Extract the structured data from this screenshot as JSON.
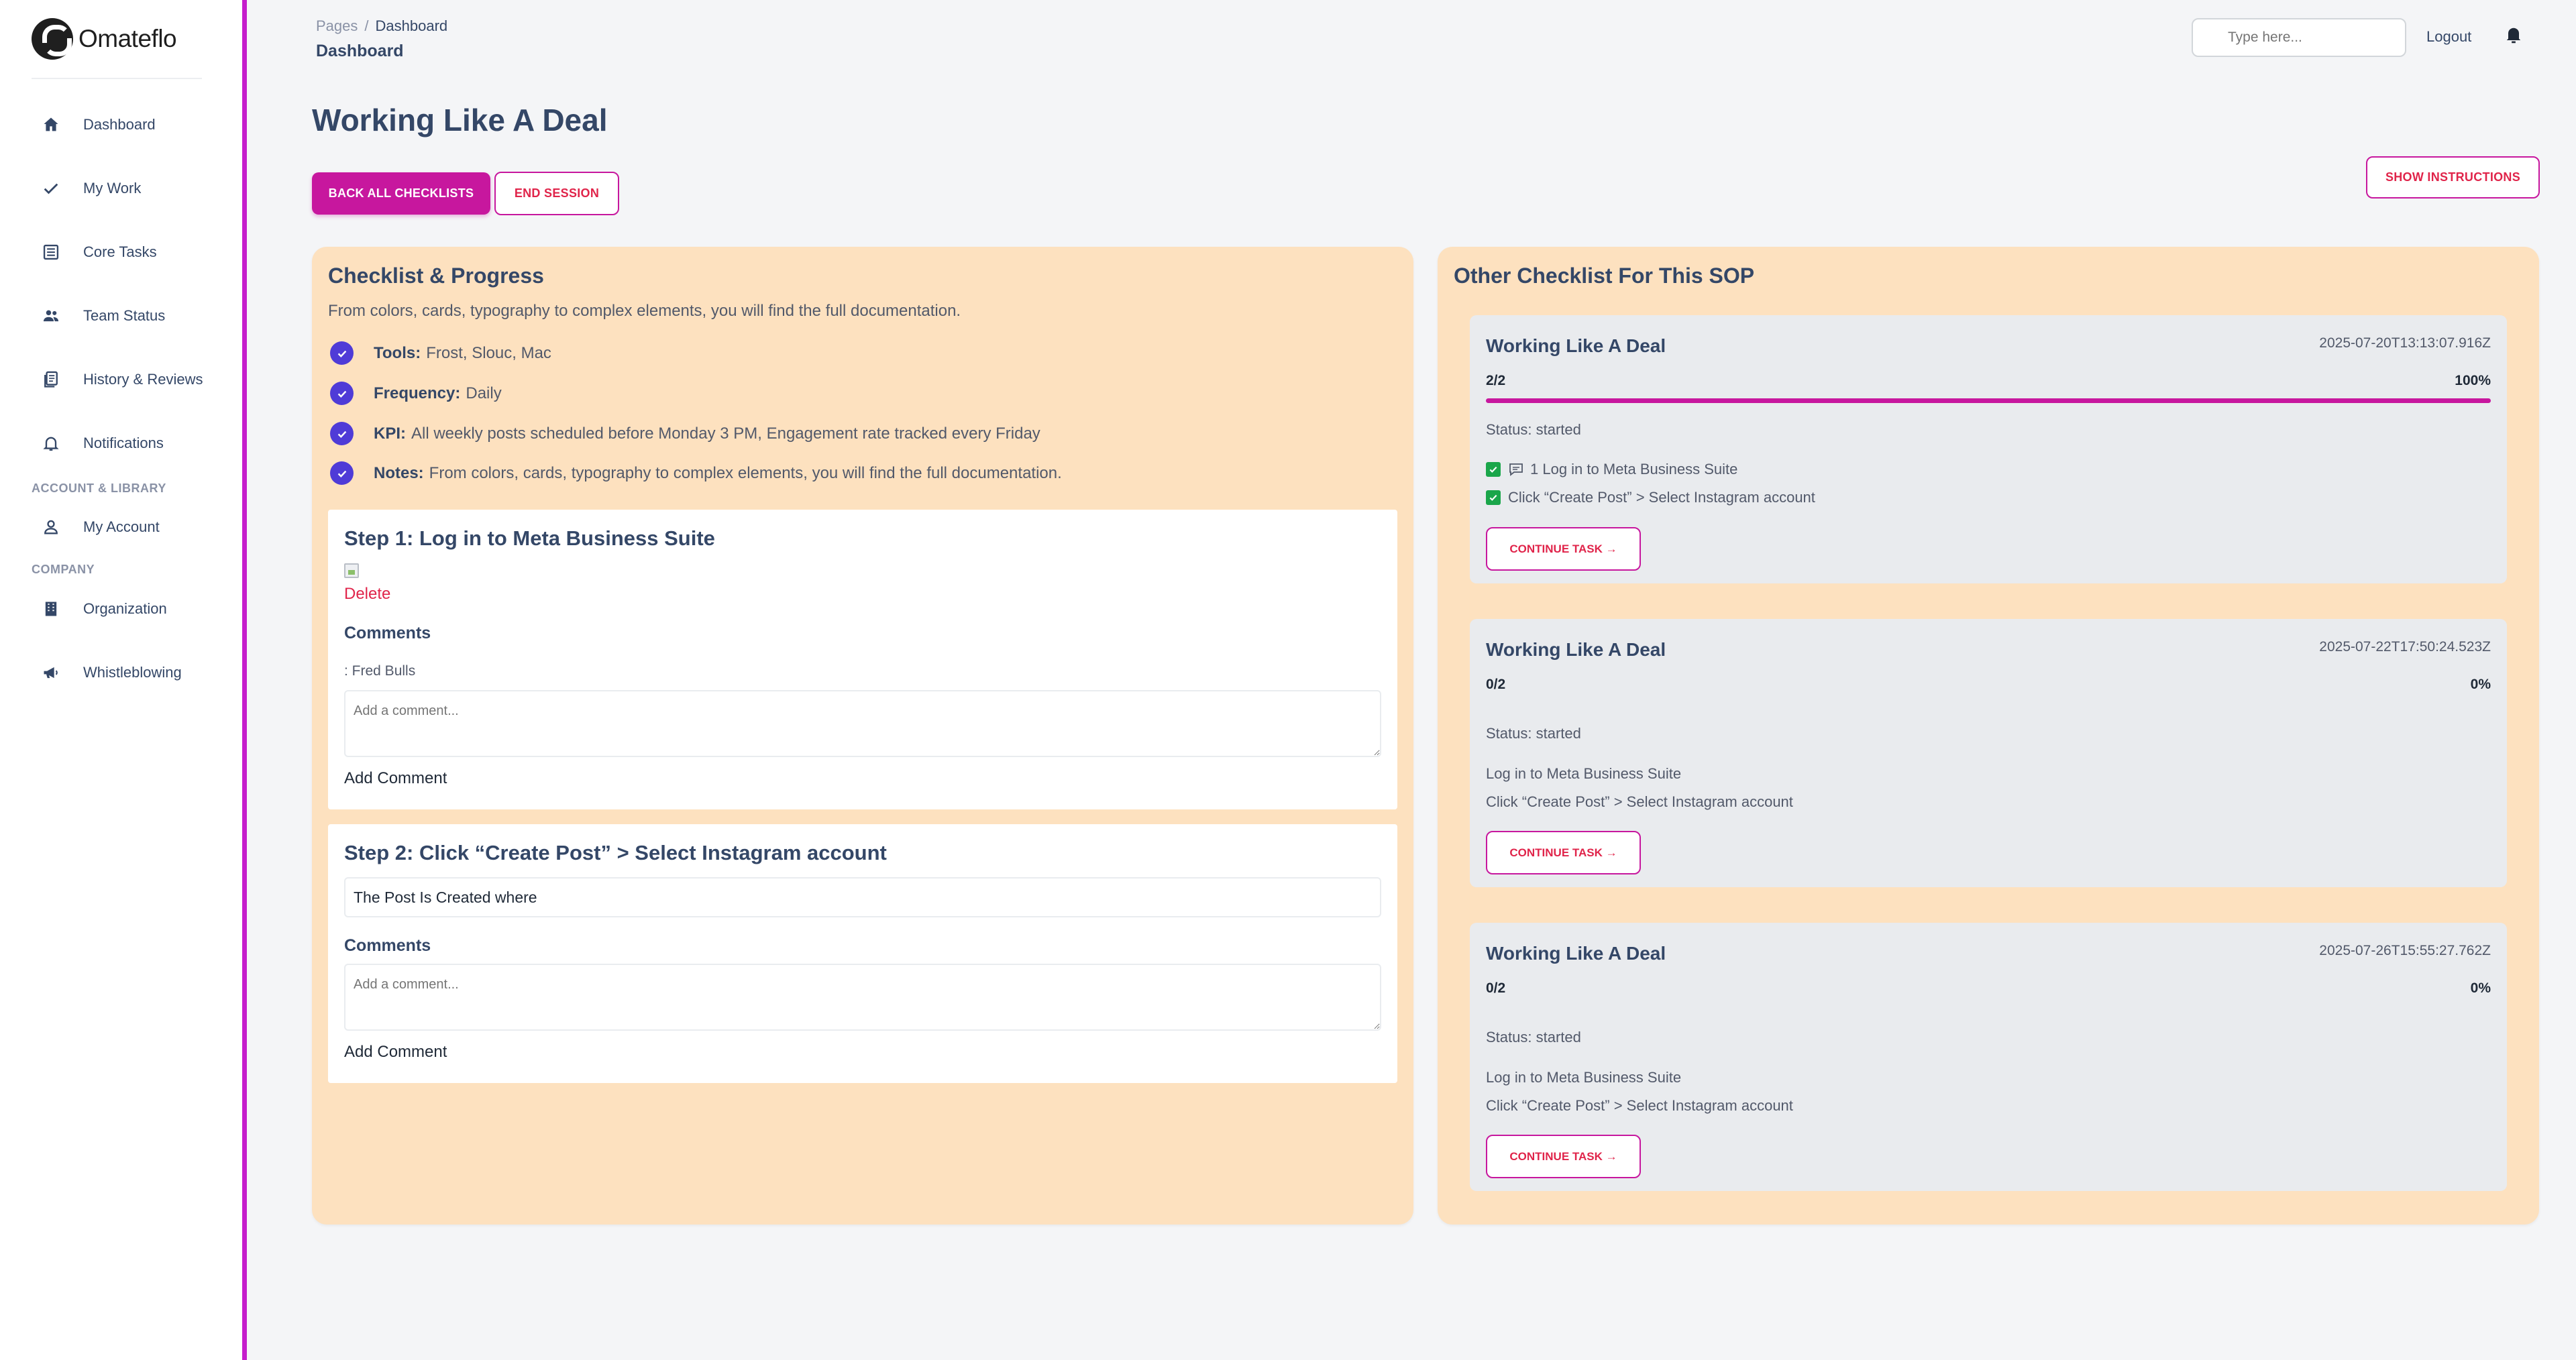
{
  "brand": {
    "name": "Omateflo"
  },
  "sidebar": {
    "items": [
      {
        "label": "Dashboard",
        "icon": "home-icon"
      },
      {
        "label": "My Work",
        "icon": "check-icon"
      },
      {
        "label": "Core Tasks",
        "icon": "list-icon"
      },
      {
        "label": "Team Status",
        "icon": "people-icon"
      },
      {
        "label": "History & Reviews",
        "icon": "document-icon"
      },
      {
        "label": "Notifications",
        "icon": "bell-icon"
      }
    ],
    "section_account": "ACCOUNT & LIBRARY",
    "account_items": [
      {
        "label": "My Account",
        "icon": "user-icon"
      }
    ],
    "section_company": "COMPANY",
    "company_items": [
      {
        "label": "Organization",
        "icon": "building-icon"
      },
      {
        "label": "Whistleblowing",
        "icon": "megaphone-icon"
      }
    ]
  },
  "header": {
    "breadcrumb": {
      "root": "Pages",
      "sep": "/",
      "current": "Dashboard"
    },
    "title": "Dashboard",
    "search_placeholder": "Type here...",
    "logout": "Logout"
  },
  "page": {
    "title": "Working Like A Deal",
    "back_button": "BACK ALL CHECKLISTS",
    "end_button": "END SESSION",
    "instructions_button": "SHOW INSTRUCTIONS"
  },
  "checklist": {
    "heading": "Checklist & Progress",
    "description": "From colors, cards, typography to complex elements, you will find the full documentation.",
    "info": [
      {
        "label": "Tools:",
        "value": "Frost, Slouc, Mac"
      },
      {
        "label": "Frequency:",
        "value": "Daily"
      },
      {
        "label": "KPI:",
        "value": "All weekly posts scheduled before Monday 3 PM, Engagement rate tracked every Friday"
      },
      {
        "label": "Notes:",
        "value": "From colors, cards, typography to complex elements, you will find the full documentation."
      }
    ],
    "steps": [
      {
        "title": "Step 1: Log in to Meta Business Suite",
        "delete": "Delete",
        "comments_label": "Comments",
        "comment_author": ": Fred Bulls",
        "comment_placeholder": "Add a comment...",
        "add_comment": "Add Comment"
      },
      {
        "title": "Step 2: Click “Create Post” > Select Instagram account",
        "field_value": "The Post Is Created where",
        "comments_label": "Comments",
        "comment_placeholder": "Add a comment...",
        "add_comment": "Add Comment"
      }
    ]
  },
  "other": {
    "heading": "Other Checklist For This SOP",
    "cards": [
      {
        "title": "Working Like A Deal",
        "timestamp": "2025-07-20T13:13:07.916Z",
        "progress": "2/2",
        "percent": "100%",
        "fill": 1.0,
        "status": "Status: started",
        "items": [
          "1 Log in to Meta Business Suite",
          "Click “Create Post” > Select Instagram account"
        ],
        "button": "CONTINUE TASK →"
      },
      {
        "title": "Working Like A Deal",
        "timestamp": "2025-07-22T17:50:24.523Z",
        "progress": "0/2",
        "percent": "0%",
        "fill": 0,
        "status": "Status: started",
        "items": [
          "Log in to Meta Business Suite",
          "Click “Create Post” > Select Instagram account"
        ],
        "button": "CONTINUE TASK →"
      },
      {
        "title": "Working Like A Deal",
        "timestamp": "2025-07-26T15:55:27.762Z",
        "progress": "0/2",
        "percent": "0%",
        "fill": 0,
        "status": "Status: started",
        "items": [
          "Log in to Meta Business Suite",
          "Click “Create Post” > Select Instagram account"
        ],
        "button": "CONTINUE TASK →"
      }
    ]
  },
  "colors": {
    "accent": "#c7179e",
    "sidebar_border": "#c51dcc",
    "panel_bg": "#fde1bf",
    "check": "#4f3bd7",
    "danger": "#e0244a"
  }
}
